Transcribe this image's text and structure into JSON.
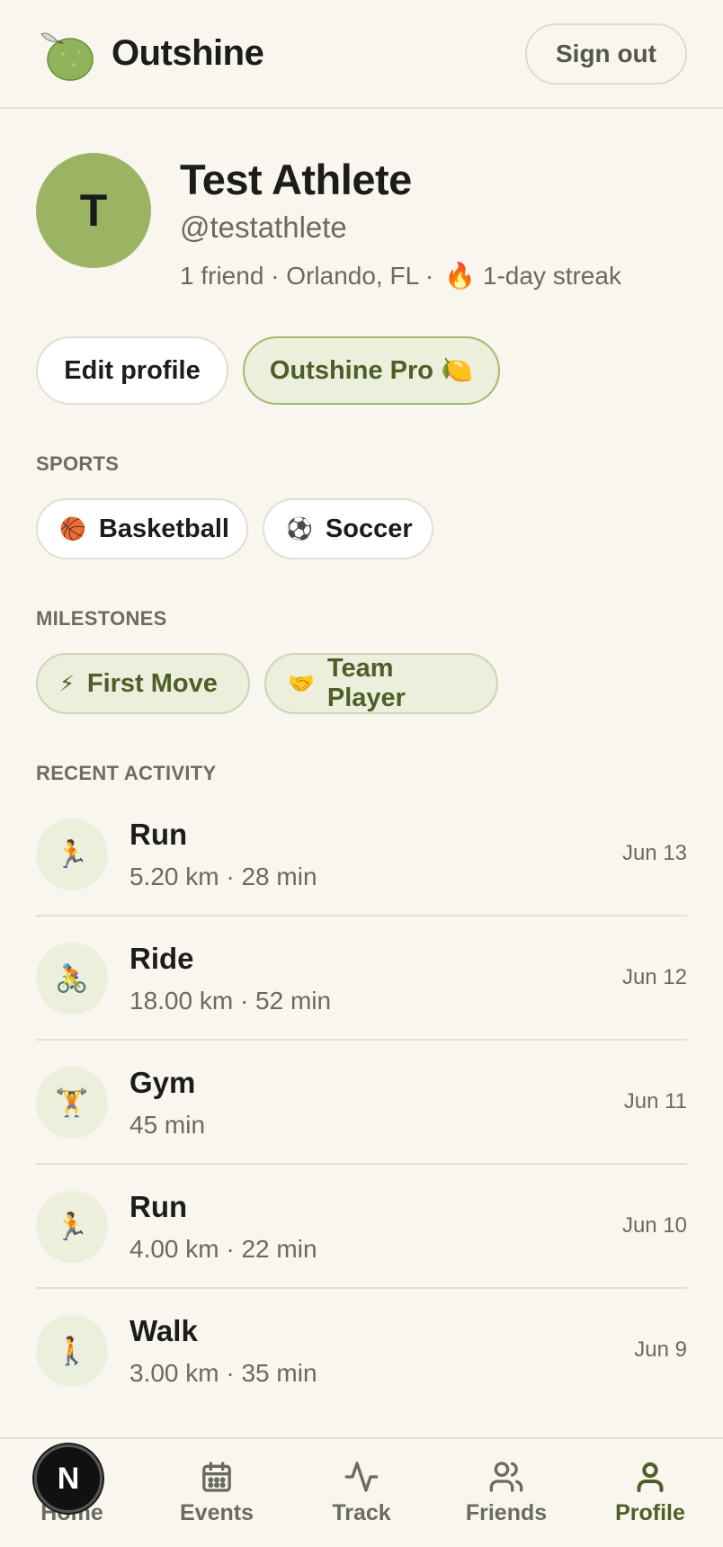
{
  "header": {
    "brand": "Outshine",
    "sign_out": "Sign out"
  },
  "profile": {
    "avatar_initial": "T",
    "name": "Test Athlete",
    "handle": "@testathlete",
    "friends": "1 friend",
    "location": "Orlando, FL",
    "streak_icon": "🔥",
    "streak": "1-day streak",
    "separator": "·"
  },
  "actions": {
    "edit_profile": "Edit profile",
    "pro": "Outshine Pro",
    "pro_icon": "🍋"
  },
  "sports": {
    "label": "SPORTS",
    "items": [
      {
        "icon": "🏀",
        "label": "Basketball"
      },
      {
        "icon": "⚽",
        "label": "Soccer"
      }
    ]
  },
  "milestones": {
    "label": "MILESTONES",
    "items": [
      {
        "icon": "⚡",
        "label": "First Move"
      },
      {
        "icon": "🤝",
        "label": "Team Player"
      }
    ]
  },
  "activity": {
    "label": "RECENT ACTIVITY",
    "items": [
      {
        "icon": "🏃",
        "title": "Run",
        "detail": "5.20 km · 28 min",
        "date": "Jun 13"
      },
      {
        "icon": "🚴",
        "title": "Ride",
        "detail": "18.00 km · 52 min",
        "date": "Jun 12"
      },
      {
        "icon": "🏋️",
        "title": "Gym",
        "detail": "45 min",
        "date": "Jun 11"
      },
      {
        "icon": "🏃",
        "title": "Run",
        "detail": "4.00 km · 22 min",
        "date": "Jun 10"
      },
      {
        "icon": "🚶",
        "title": "Walk",
        "detail": "3.00 km · 35 min",
        "date": "Jun 9"
      }
    ]
  },
  "nav": {
    "items": [
      {
        "icon": "home-icon",
        "label": "Home"
      },
      {
        "icon": "calendar-icon",
        "label": "Events"
      },
      {
        "icon": "activity-icon",
        "label": "Track"
      },
      {
        "icon": "users-icon",
        "label": "Friends"
      },
      {
        "icon": "user-icon",
        "label": "Profile"
      }
    ],
    "active": "Profile",
    "overlay_badge": "N"
  },
  "colors": {
    "background": "#f8f6ee",
    "accent": "#9bb464",
    "accent_dark": "#4f5e26"
  }
}
